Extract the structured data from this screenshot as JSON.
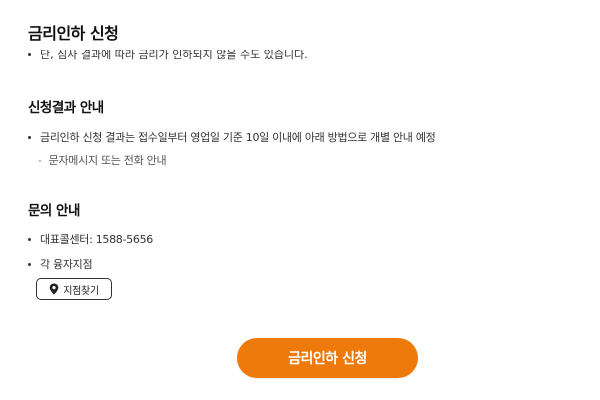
{
  "header": {
    "title": "금리인하 신청"
  },
  "notice": {
    "clipped_text": "단, 심사 결과에 따라 금리가 인하되지 않을 수도 있습니다."
  },
  "result_section": {
    "title": "신청결과 안내",
    "bullet": "금리인하 신청 결과는 접수일부터 영업일 기준 10일 이내에 아래 방법으로 개별 안내 예정",
    "sub_item": "문자메시지 또는 전화 안내"
  },
  "inquiry_section": {
    "title": "문의 안내",
    "items": [
      "대표콜센터: 1588-5656",
      "각 융자지점"
    ],
    "branch_button_label": "지점찾기",
    "branch_button_icon": "location-pin-icon"
  },
  "footer": {
    "apply_button_label": "금리인하 신청"
  },
  "colors": {
    "accent": "#ee7a0c",
    "text": "#222222"
  }
}
